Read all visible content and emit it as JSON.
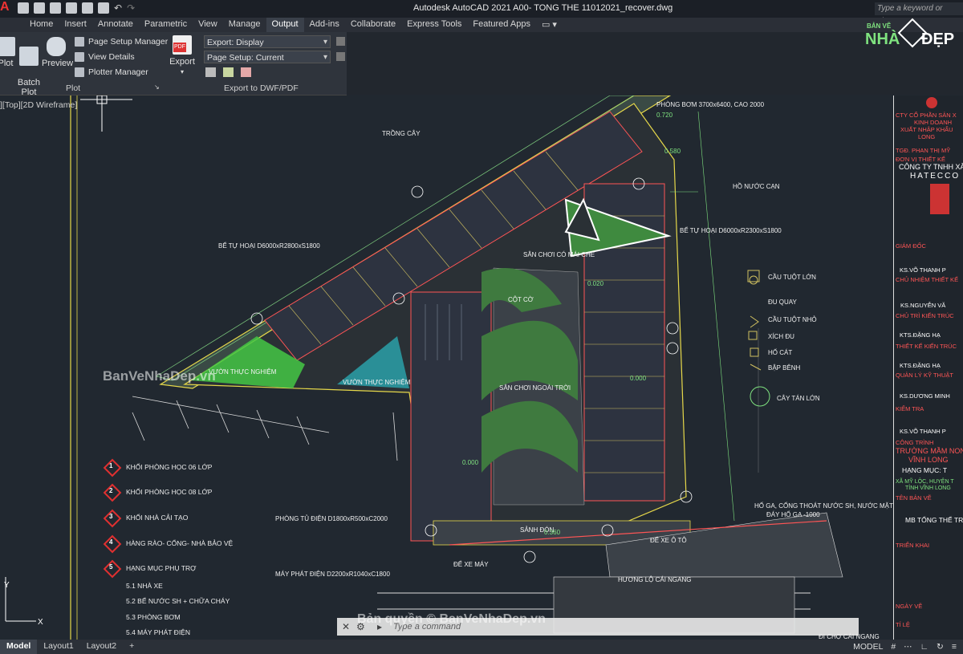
{
  "title_bar": {
    "app_title": "Autodesk AutoCAD 2021    A00- TONG THE 11012021_recover.dwg",
    "search_placeholder": "Type a keyword or phrase"
  },
  "menu_tabs": [
    "Home",
    "Insert",
    "Annotate",
    "Parametric",
    "View",
    "Manage",
    "Output",
    "Add-ins",
    "Collaborate",
    "Express Tools",
    "Featured Apps"
  ],
  "active_tab": "Output",
  "ribbon": {
    "plot_label": "Plot",
    "batch_plot_label": "Batch\nPlot",
    "preview_label": "Preview",
    "page_setup_manager": "Page Setup Manager",
    "view_details": "View Details",
    "plotter_manager": "Plotter Manager",
    "plot_panel_title": "Plot",
    "export_label": "Export",
    "export_display": "Export: Display",
    "page_setup_current": "Page Setup: Current",
    "export_panel_title": "Export to DWF/PDF"
  },
  "viewport_label": "][Top][2D Wireframe]",
  "legend": [
    {
      "num": "1",
      "text": "KHỐI PHÒNG HỌC 06 LỚP"
    },
    {
      "num": "2",
      "text": "KHỐI PHÒNG HỌC 08 LỚP"
    },
    {
      "num": "3",
      "text": "KHỐI NHÀ CẢI TẠO"
    },
    {
      "num": "4",
      "text": "HÀNG RÀO- CỔNG- NHÀ BẢO VỆ"
    },
    {
      "num": "5",
      "text": "HẠNG MỤC PHỤ TRỢ"
    }
  ],
  "legend_sub": [
    "5.1 NHÀ XE",
    "5.2 BỂ NƯỚC SH + CHỮA CHÁY",
    "5.3 PHÒNG BƠM",
    "5.4 MÁY PHÁT ĐIỆN"
  ],
  "play_legend": [
    "CẦU TUỘT LỚN",
    "ĐU QUAY",
    "CẦU TUỘT NHỎ",
    "XÍCH ĐU",
    "HỐ CÁT",
    "BẬP BÊNH",
    "CÂY TÁN LỚN"
  ],
  "drawing_labels": {
    "phong_bom": "PHÒNG BƠM 3700x6400, CAO 2000",
    "trong_cay": "TRỒNG CÂY",
    "ho_nuoc_can": "HỒ NƯỚC CẠN",
    "be_tu_hoai_1": "BỂ TỰ HOẠI D6000xR2800xS1800",
    "be_tu_hoai_2": "BỂ TỰ HOẠI D6000xR2300xS1800",
    "san_choi_co_mai_che": "SÂN CHƠI CÓ MÁI CHE",
    "vuon_thuc_nghiem_1": "VƯỜN THỰC NGHIỆM",
    "vuon_thuc_nghiem_2": "VƯỜN THỰC NGHIỆM",
    "cot_co": "CỘT CỜ",
    "san_choi_ngoai_troi": "SÂN CHƠI NGOÀI TRỜI",
    "sanh_don": "SẢNH ĐÓN",
    "phong_tu_dien": "PHÒNG TỦ ĐIỆN D1800xR500xC2000",
    "may_phat_dien": "MÁY PHÁT ĐIỆN D2200xR1040xC1800",
    "de_xe_may": "ĐỂ XE MÁY",
    "de_xe_oto": "ĐỂ XE Ô TÔ",
    "ho_ga": "HỐ GA, CỐNG THOÁT NƯỚC SH, NƯỚC MẶT",
    "day_ho_ga": "ĐÁY HỐ GA -1000",
    "huong_lo": "HƯƠNG LỘ CÁI NGANG",
    "di_cho": "ĐI CHỢ CÁI NGANG",
    "elev_1": "0.720",
    "elev_2": "0.580",
    "elev_3": "0.020",
    "elev_4": "0.000",
    "elev_5": "0.360",
    "elev_6": "0.000"
  },
  "title_block": [
    {
      "text": "CTY CỔ PHẦN SẢN X",
      "color": "#ff5555"
    },
    {
      "text": "KINH DOANH",
      "color": "#ff5555"
    },
    {
      "text": "XUẤT NHẬP KHẨU",
      "color": "#ff5555"
    },
    {
      "text": "LONG",
      "color": "#ff5555"
    },
    {
      "text": "TGĐ. PHAN THỊ MỸ",
      "color": "#ff5555"
    },
    {
      "text": "ĐƠN VỊ THIẾT KẾ",
      "color": "#ff5555"
    },
    {
      "text": "CÔNG TY TNHH XÂY",
      "color": "#ffffff"
    },
    {
      "text": "HATECCO",
      "color": "#ffffff"
    },
    {
      "text": "GIÁM ĐỐC",
      "color": "#ff5555"
    },
    {
      "text": "KS.VÕ THANH P",
      "color": "#ffffff"
    },
    {
      "text": "CHỦ NHIỆM THIẾT KẾ",
      "color": "#ff5555"
    },
    {
      "text": "KS.NGUYỄN VĂ",
      "color": "#ffffff"
    },
    {
      "text": "CHỦ TRÌ KIẾN TRÚC",
      "color": "#ff5555"
    },
    {
      "text": "KTS.ĐẶNG HẠ",
      "color": "#ffffff"
    },
    {
      "text": "THIẾT KẾ KIẾN TRÚC",
      "color": "#ff5555"
    },
    {
      "text": "KTS.ĐẶNG HẠ",
      "color": "#ffffff"
    },
    {
      "text": "QUẢN LÝ KỸ THUẬT",
      "color": "#ff5555"
    },
    {
      "text": "KS.DƯƠNG MINH",
      "color": "#ffffff"
    },
    {
      "text": "KIỂM TRA",
      "color": "#ff5555"
    },
    {
      "text": "KS.VÕ THANH P",
      "color": "#ffffff"
    },
    {
      "text": "CÔNG TRÌNH",
      "color": "#ff5555"
    },
    {
      "text": "TRƯỜNG MẦM NON C",
      "color": "#ff5555"
    },
    {
      "text": "VĨNH LONG",
      "color": "#ff5555"
    },
    {
      "text": "HẠNG MỤC: T",
      "color": "#ffffff"
    },
    {
      "text": "XÃ MỸ LỘC, HUYỆN T",
      "color": "#7fe27f"
    },
    {
      "text": "TỈNH VĨNH LONG",
      "color": "#7fe27f"
    },
    {
      "text": "TÊN BẢN VẼ",
      "color": "#ff5555"
    },
    {
      "text": "MB TỔNG THỂ TR",
      "color": "#ffffff"
    },
    {
      "text": "TRIỂN KHAI",
      "color": "#ff5555"
    },
    {
      "text": "NGÀY VẼ",
      "color": "#ff5555"
    },
    {
      "text": "TỈ LỆ",
      "color": "#ff5555"
    }
  ],
  "command_placeholder": "Type a command",
  "layout_tabs": [
    "Model",
    "Layout1",
    "Layout2"
  ],
  "add_layout": "+",
  "status_model": "MODEL",
  "watermarks": {
    "left": "BanVeNhaDep.vn",
    "bottom": "Bản quyền © BanVeNhaDep.vn",
    "logo_top": "BẢN VẼ",
    "logo_nha": "NHÀ",
    "logo_dep": "ĐẸP"
  }
}
